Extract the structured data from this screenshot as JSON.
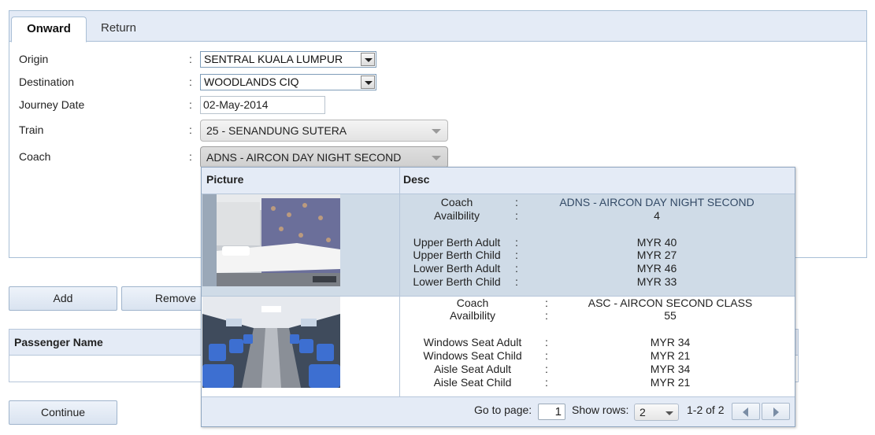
{
  "tabs": [
    {
      "label": "Onward",
      "active": true
    },
    {
      "label": "Return",
      "active": false
    }
  ],
  "form": {
    "origin": {
      "label": "Origin",
      "value": "SENTRAL KUALA LUMPUR"
    },
    "destination": {
      "label": "Destination",
      "value": "WOODLANDS CIQ"
    },
    "journey_date": {
      "label": "Journey Date",
      "value": "02-May-2014"
    },
    "train": {
      "label": "Train",
      "value": "25 - SENANDUNG SUTERA"
    },
    "coach": {
      "label": "Coach",
      "value": "ADNS - AIRCON DAY NIGHT SECOND"
    },
    "colon": ":"
  },
  "buttons": {
    "add": "Add",
    "remove": "Remove",
    "continue": "Continue"
  },
  "passenger_table": {
    "header": "Passenger Name"
  },
  "coach_dropdown": {
    "columns": [
      "Picture",
      "Desc"
    ],
    "rows": [
      {
        "selected": true,
        "image": "sleeper-berth-photo",
        "fields": [
          {
            "key": "Coach",
            "value": "ADNS - AIRCON DAY NIGHT SECOND"
          },
          {
            "key": "Availbility",
            "value": "4"
          },
          {
            "key": "Upper Berth Adult",
            "value": "MYR 40"
          },
          {
            "key": "Upper Berth Child",
            "value": "MYR 27"
          },
          {
            "key": "Lower Berth Adult",
            "value": "MYR 46"
          },
          {
            "key": "Lower Berth Child",
            "value": "MYR 33"
          }
        ]
      },
      {
        "selected": false,
        "image": "seated-coach-photo",
        "fields": [
          {
            "key": "Coach",
            "value": "ASC - AIRCON SECOND CLASS"
          },
          {
            "key": "Availbility",
            "value": "55"
          },
          {
            "key": "Windows Seat Adult",
            "value": "MYR 34"
          },
          {
            "key": "Windows Seat Child",
            "value": "MYR 21"
          },
          {
            "key": "Aisle Seat Adult",
            "value": "MYR 34"
          },
          {
            "key": "Aisle Seat Child",
            "value": "MYR 21"
          }
        ]
      }
    ],
    "pager": {
      "goto_label": "Go to page:",
      "page": "1",
      "rows_label": "Show rows:",
      "rows_value": "2",
      "range": "1-2 of 2"
    }
  },
  "colors": {
    "header_bg": "#e4ebf6",
    "selected_row_bg": "#cfdbe7",
    "border": "#a9bfd6",
    "selected_coach_text": "#334a66"
  }
}
